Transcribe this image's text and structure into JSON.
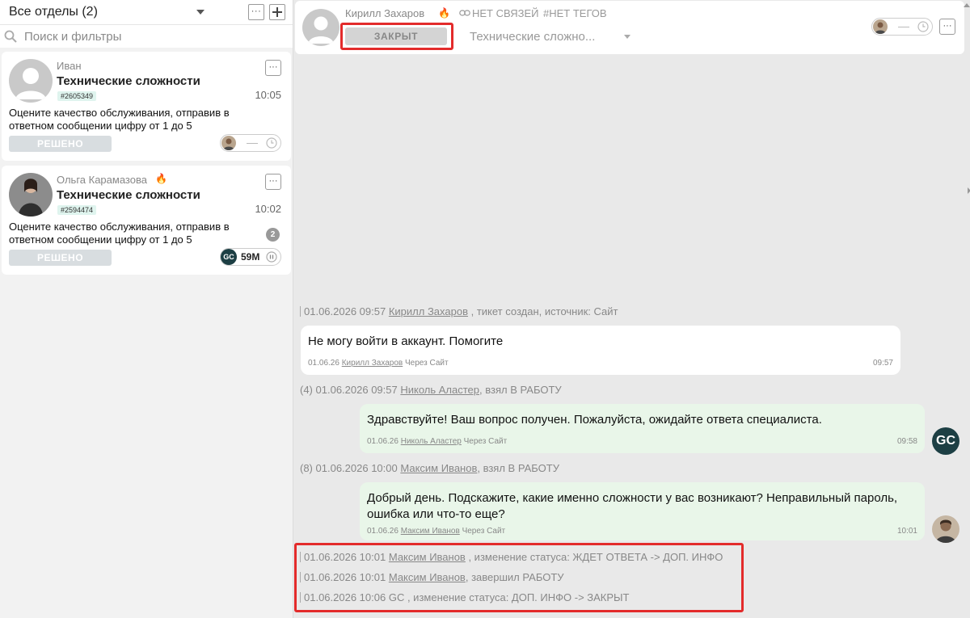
{
  "sidebar": {
    "department_title": "Все отделы (2)",
    "search_placeholder": "Поиск и фильтры",
    "tickets": [
      {
        "name": "Иван",
        "topic": "Технические сложности",
        "id": "#2605349",
        "time": "10:05",
        "preview": "Оцените качество обслуживания, отправив в ответном сообщении цифру от 1 до 5",
        "status": "РЕШЕНО"
      },
      {
        "name": "Ольга Карамазова",
        "topic": "Технические сложности",
        "id": "#2594474",
        "time": "10:02",
        "preview": "Оцените качество обслуживания, отправив в ответном сообщении цифру от 1 до 5",
        "status": "РЕШЕНО",
        "unread": "2",
        "timer_badge": "GC",
        "timer_value": "59M"
      }
    ]
  },
  "header": {
    "name": "Кирилл Захаров",
    "no_links": "НЕТ СВЯЗЕЙ",
    "no_tags": "#НЕТ ТЕГОВ",
    "status": "ЗАКРЫТ",
    "topic": "Технические сложно..."
  },
  "events": {
    "created": {
      "time": "01.06.2026 09:57",
      "who": "Кирилл Захаров",
      "text": " , тикет создан, источник: Сайт"
    },
    "took1": {
      "num": "(4)",
      "time": "01.06.2026 09:57",
      "who": "Николь Аластер",
      "text": ", взял В РАБОТУ"
    },
    "took2": {
      "num": "(8)",
      "time": "01.06.2026 10:00",
      "who": "Максим Иванов",
      "text": ", взял В РАБОТУ"
    },
    "status1": {
      "time": "01.06.2026 10:01",
      "who": "Максим Иванов",
      "text": " , изменение статуса: ЖДЕТ ОТВЕТА -> ДОП. ИНФО"
    },
    "finished": {
      "time": "01.06.2026 10:01",
      "who": "Максим Иванов",
      "text": ", завершил РАБОТУ"
    },
    "status2": {
      "time": "01.06.2026 10:06",
      "text": "GC , изменение статуса: ДОП. ИНФО -> ЗАКРЫТ"
    }
  },
  "messages": [
    {
      "text": "Не могу войти в аккаунт. Помогите",
      "date": "01.06.26",
      "who": "Кирилл Захаров",
      "via": " Через Сайт",
      "time": "09:57"
    },
    {
      "text": "Здравствуйте! Ваш вопрос получен. Пожалуйста, ожидайте ответа специалиста.",
      "date": "01.06.26",
      "who": "Николь Аластер",
      "via": " Через Сайт",
      "time": "09:58",
      "avatar": "GC"
    },
    {
      "text": "Добрый день. Подскажите, какие именно сложности у вас возникают? Неправильный пароль, ошибка или что-то еще?",
      "date": "01.06.26",
      "who": "Максим Иванов",
      "via": " Через Сайт",
      "time": "10:01"
    }
  ],
  "colors": {
    "highlight": "#e32b2b",
    "outgoing_bubble": "#e9f6e9",
    "status_chip": "#d8dde0",
    "gc_badge": "#1d3f44"
  }
}
